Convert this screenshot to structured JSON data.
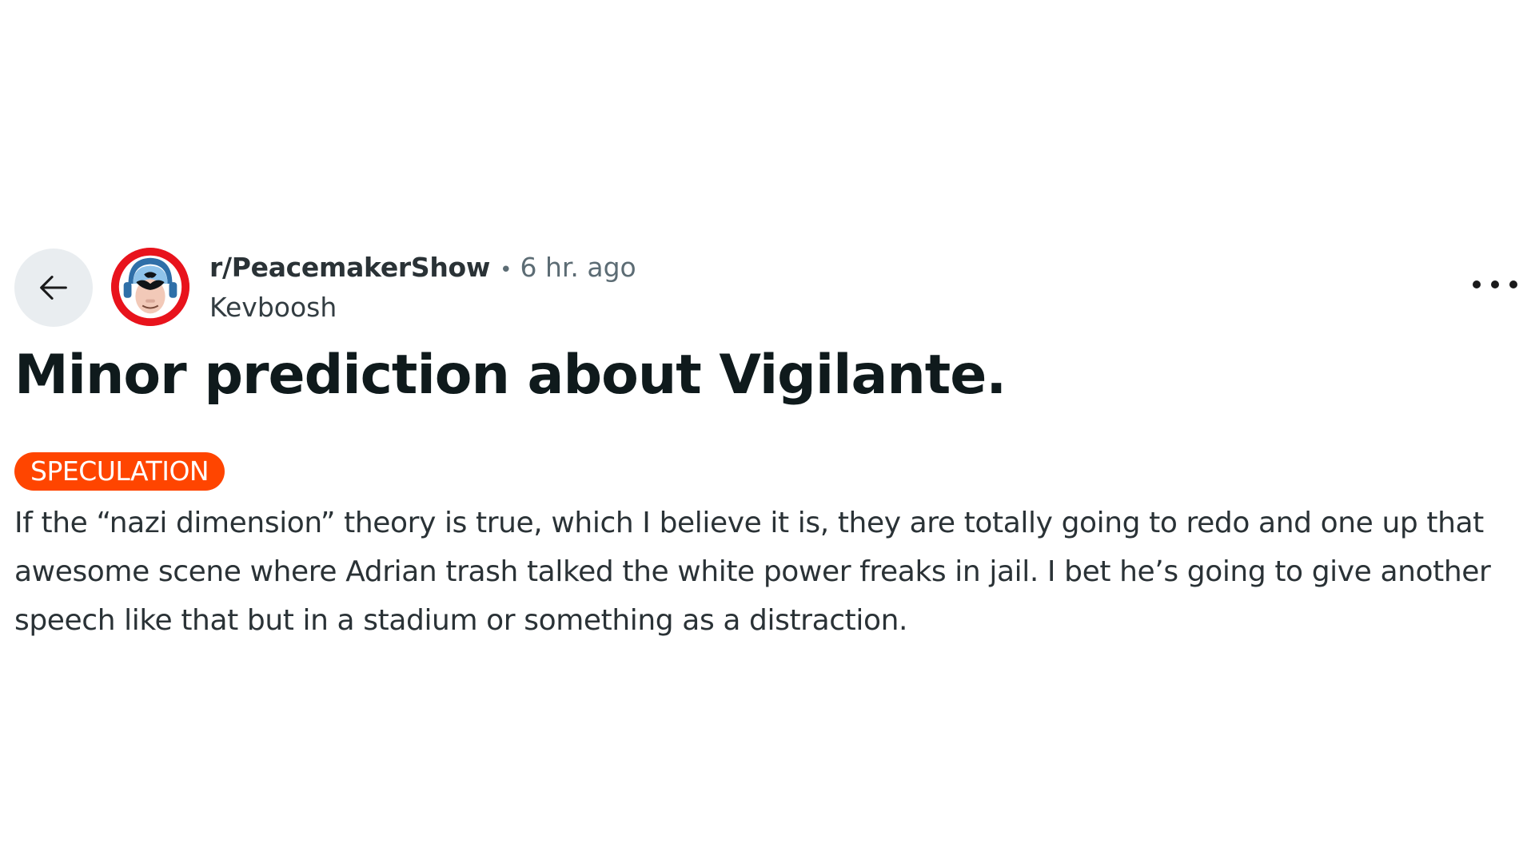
{
  "post": {
    "subreddit": "r/PeacemakerShow",
    "separator": "•",
    "time": "6 hr. ago",
    "author": "Kevboosh",
    "title": "Minor prediction about Vigilante.",
    "flair": {
      "label": "SPECULATION",
      "color": "#ff4500"
    },
    "body": "If the “nazi dimension” theory is true, which I believe it is, they are totally going to redo and one up that awesome scene where Adrian trash talked the white power freaks in jail. I bet he’s going to give another speech like that but in a stadium or something as a distraction."
  },
  "icons": {
    "back": "arrow-left-icon",
    "more": "more-horizontal-icon",
    "avatar": "subreddit-avatar"
  },
  "colors": {
    "avatar_ring": "#e8131c",
    "back_button_bg": "#e9edf0",
    "meta_text": "#5c6c74"
  }
}
